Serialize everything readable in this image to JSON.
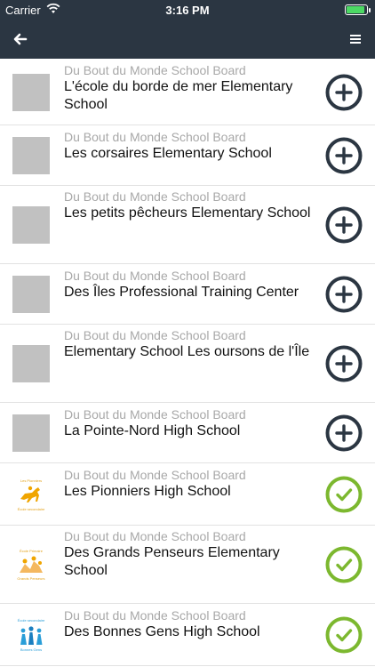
{
  "status": {
    "carrier": "Carrier",
    "time": "3:16 PM",
    "battery_level": 0.9
  },
  "colors": {
    "bar": "#2b3642",
    "add": "#2b3642",
    "added": "#7cb82f",
    "placeholder": "#c1c1c1"
  },
  "icons": {
    "back": "arrow-left-icon",
    "menu": "hamburger-menu-icon",
    "add": "plus-circle-icon",
    "added": "check-circle-icon"
  },
  "schools": [
    {
      "board": "Du Bout du Monde School Board",
      "name": "L'école du borde de mer Elementary School",
      "status": "add",
      "logo": "placeholder"
    },
    {
      "board": "Du Bout du Monde School Board",
      "name": "Les corsaires Elementary School",
      "status": "add",
      "logo": "placeholder"
    },
    {
      "board": "Du Bout du Monde School Board",
      "name": "Les petits pêcheurs Elementary School",
      "status": "add",
      "logo": "placeholder"
    },
    {
      "board": "Du Bout du Monde School Board",
      "name": "Des Îles Professional Training Center",
      "status": "add",
      "logo": "placeholder"
    },
    {
      "board": "Du Bout du Monde School Board",
      "name": "Elementary School Les oursons de l'Île",
      "status": "add",
      "logo": "placeholder"
    },
    {
      "board": "Du Bout du Monde School Board",
      "name": "La Pointe-Nord High School",
      "status": "add",
      "logo": "placeholder"
    },
    {
      "board": "Du Bout du Monde School Board",
      "name": "Les Pionniers High School",
      "status": "added",
      "logo": "horse-rider-logo"
    },
    {
      "board": "Du Bout du Monde School Board",
      "name": "Des Grands Penseurs Elementary School",
      "status": "added",
      "logo": "thinkers-logo"
    },
    {
      "board": "Du Bout du Monde School Board",
      "name": "Des Bonnes Gens High School",
      "status": "added",
      "logo": "people-logo"
    }
  ]
}
